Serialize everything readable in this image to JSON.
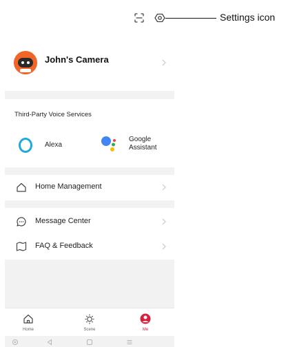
{
  "profile": {
    "name": "John's Camera"
  },
  "voice_services": {
    "title": "Third-Party Voice Services",
    "alexa_label": "Alexa",
    "google_label_line1": "Google",
    "google_label_line2": "Assistant"
  },
  "menu": {
    "home_management": "Home Management",
    "message_center": "Message Center",
    "faq_feedback": "FAQ & Feedback"
  },
  "tabs": {
    "home": "Home",
    "scene": "Scene",
    "me": "Me"
  },
  "callout": {
    "label": "Settings icon"
  },
  "colors": {
    "accent": "#d8203f",
    "avatar": "#f16529",
    "alexa": "#1ea8e0"
  }
}
